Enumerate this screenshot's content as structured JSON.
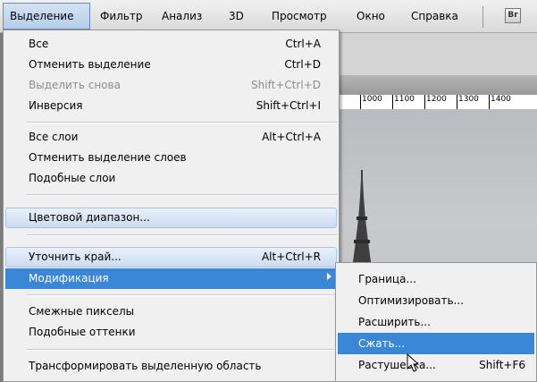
{
  "menubar": {
    "items": [
      {
        "label": "Выделение",
        "active": true
      },
      {
        "label": "Фильтр"
      },
      {
        "label": "Анализ"
      },
      {
        "label": "3D"
      },
      {
        "label": "Просмотр"
      },
      {
        "label": "Окно"
      },
      {
        "label": "Справка"
      }
    ],
    "bridge_button": "Br"
  },
  "ruler": {
    "labels": [
      "1000",
      "1100",
      "1200",
      "1300",
      "1400"
    ]
  },
  "menu": {
    "items": [
      {
        "label": "Все",
        "shortcut": "Ctrl+A"
      },
      {
        "label": "Отменить выделение",
        "shortcut": "Ctrl+D"
      },
      {
        "label": "Выделить снова",
        "shortcut": "Shift+Ctrl+D",
        "disabled": true
      },
      {
        "label": "Инверсия",
        "shortcut": "Shift+Ctrl+I"
      },
      {
        "label": "Все слои",
        "shortcut": "Alt+Ctrl+A"
      },
      {
        "label": "Отменить выделение слоев",
        "shortcut": ""
      },
      {
        "label": "Подобные слои",
        "shortcut": ""
      },
      {
        "label": "Цветовой диапазон...",
        "shortcut": ""
      },
      {
        "label": "Уточнить край...",
        "shortcut": "Alt+Ctrl+R"
      },
      {
        "label": "Модификация",
        "shortcut": "",
        "submenu": true
      },
      {
        "label": "Смежные пикселы",
        "shortcut": ""
      },
      {
        "label": "Подобные оттенки",
        "shortcut": ""
      },
      {
        "label": "Трансформировать выделенную область",
        "shortcut": ""
      }
    ]
  },
  "submenu": {
    "items": [
      {
        "label": "Граница...",
        "shortcut": ""
      },
      {
        "label": "Оптимизировать...",
        "shortcut": ""
      },
      {
        "label": "Расширить...",
        "shortcut": ""
      },
      {
        "label": "Сжать...",
        "shortcut": "",
        "selected": true
      },
      {
        "label": "Растушевка...",
        "shortcut": "Shift+F6"
      }
    ]
  },
  "colors": {
    "highlight": "#3a87d8",
    "menu_bg": "#f0f0f0"
  }
}
